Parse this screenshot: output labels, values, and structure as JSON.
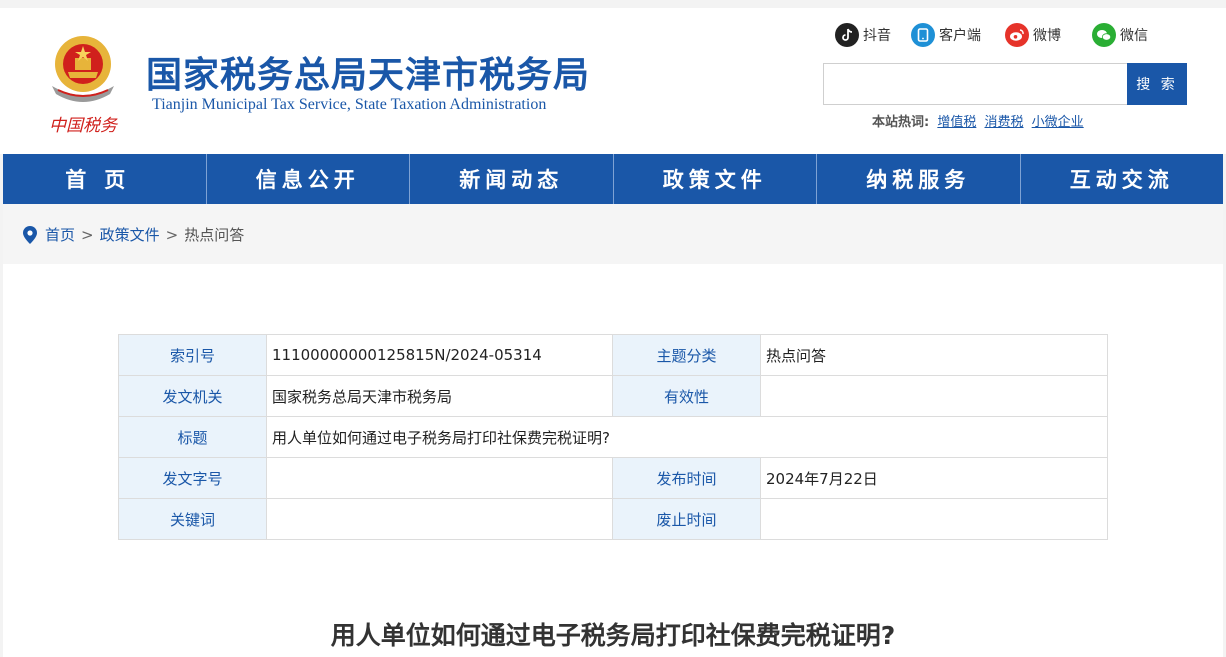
{
  "header": {
    "title": "国家税务总局天津市税务局",
    "subtitle": "Tianjin Municipal Tax Service, State Taxation Administration",
    "emblem_text": "中国税务"
  },
  "social": {
    "douyin": "抖音",
    "client": "客户端",
    "weibo": "微博",
    "wechat": "微信"
  },
  "search": {
    "value": "",
    "button_label": "搜 索"
  },
  "hot": {
    "label": "本站热词:",
    "items": [
      "增值税",
      "消费税",
      "小微企业"
    ]
  },
  "nav": [
    "首页",
    "信息公开",
    "新闻动态",
    "政策文件",
    "纳税服务",
    "互动交流"
  ],
  "breadcrumb": {
    "home": "首页",
    "level1": "政策文件",
    "current": "热点问答",
    "separator": ">"
  },
  "meta": {
    "index_no_label": "索引号",
    "index_no": "11100000000125815N/2024-05314",
    "topic_label": "主题分类",
    "topic": "热点问答",
    "issuer_label": "发文机关",
    "issuer": "国家税务总局天津市税务局",
    "validity_label": "有效性",
    "validity": "",
    "title_label": "标题",
    "title": "用人单位如何通过电子税务局打印社保费完税证明?",
    "doc_no_label": "发文字号",
    "doc_no": "",
    "publish_label": "发布时间",
    "publish": "2024年7月22日",
    "keywords_label": "关键词",
    "keywords": "",
    "expiry_label": "废止时间",
    "expiry": ""
  },
  "article": {
    "title": "用人单位如何通过电子税务局打印社保费完税证明?"
  },
  "colors": {
    "brand_blue": "#1a57a8",
    "key_cell_bg": "#eaf3fb",
    "emblem_red": "#d0201c",
    "emblem_gold": "#e7b43a"
  }
}
